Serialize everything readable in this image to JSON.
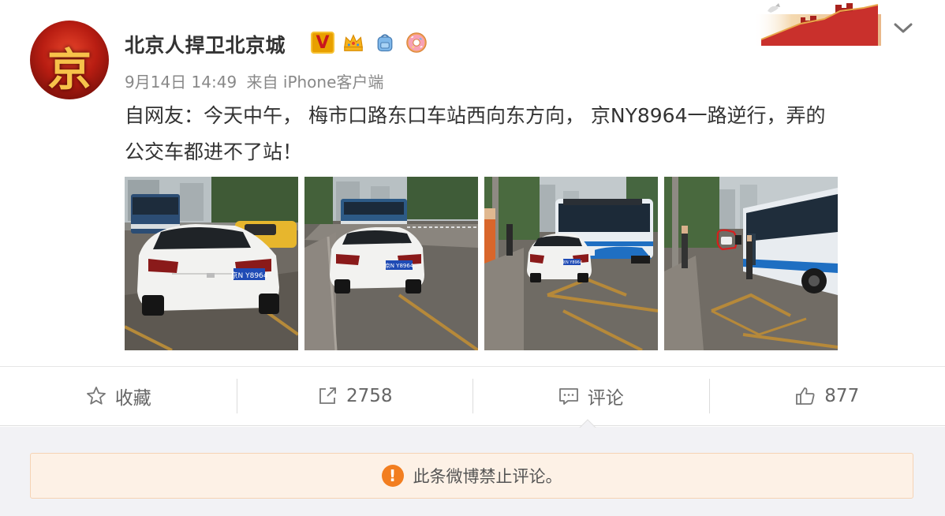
{
  "post": {
    "username": "北京人捍卫北京城",
    "avatar_glyph": "京",
    "badges": [
      {
        "name": "verified-v-badge",
        "label": "V"
      },
      {
        "name": "crown-badge"
      },
      {
        "name": "backpack-badge"
      },
      {
        "name": "donut-badge"
      }
    ],
    "timestamp": "9月14日 14:49",
    "source": "来自 iPhone客户端",
    "text_line1": "自网友：今天中午， 梅市口路东口车站西向东方向， 京NY8964一路逆行，弄的",
    "text_line2": "公交车都进不了站！",
    "photos": [
      {
        "plate": "京N Y8964"
      },
      {
        "plate": "京N Y8964"
      },
      {
        "plate": "京N Y8964"
      },
      {
        "plate": ""
      }
    ]
  },
  "actions": {
    "favorite_label": "收藏",
    "share_count": "2758",
    "comment_label": "评论",
    "like_count": "877"
  },
  "notice": {
    "icon": "!",
    "text": "此条微博禁止评论。"
  },
  "colors": {
    "notice_bg": "#fdf1e6",
    "notice_icon": "#f27e20",
    "lower_bg": "#f2f2f5"
  }
}
